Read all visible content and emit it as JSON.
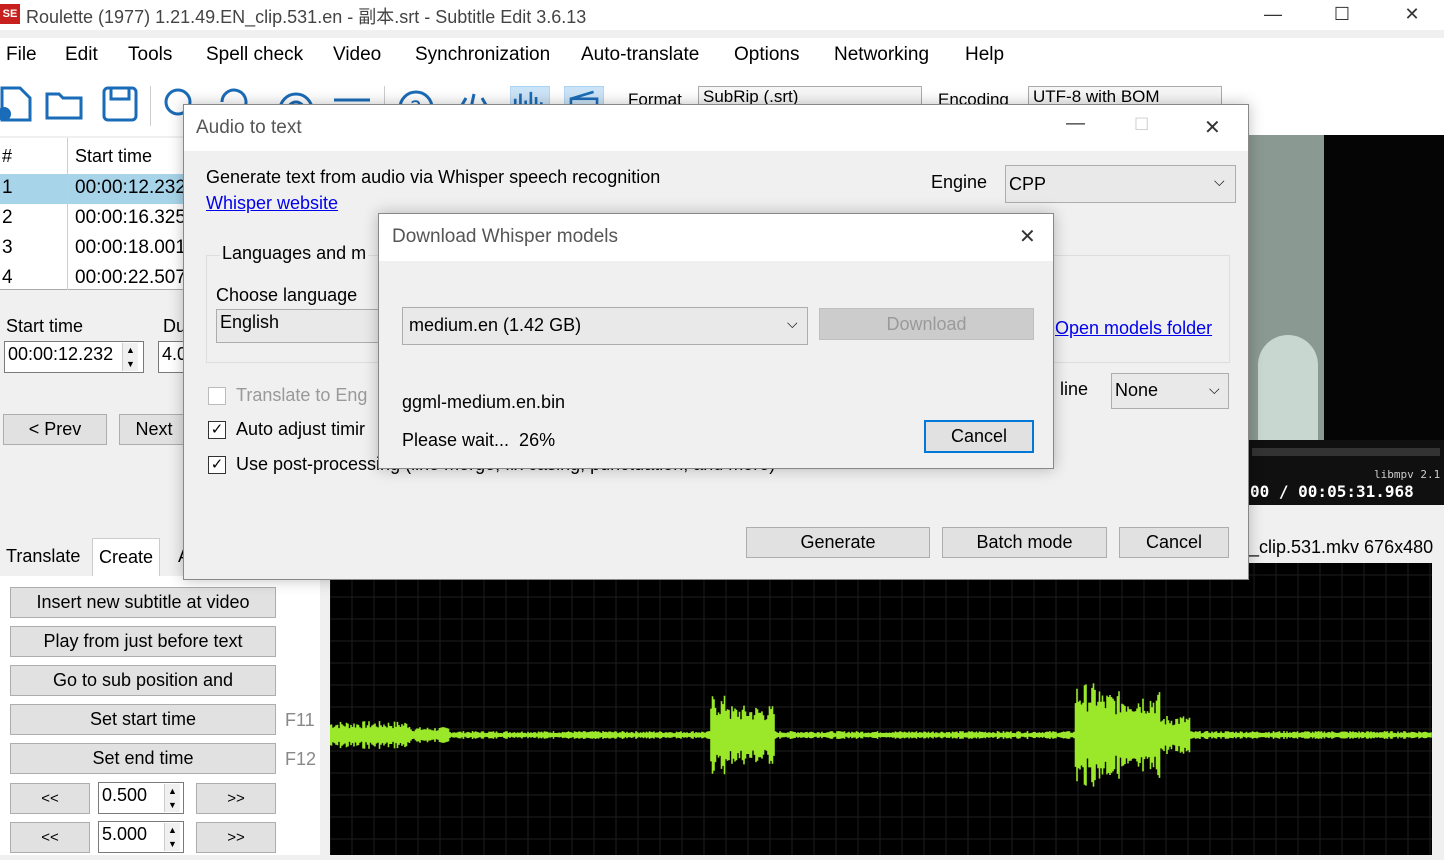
{
  "window": {
    "app_icon": "SE",
    "title": "Roulette (1977) 1.21.49.EN_clip.531.en - 副本.srt - Subtitle Edit 3.6.13",
    "minimize": "—",
    "maximize": "☐",
    "close": "✕"
  },
  "menu": [
    "File",
    "Edit",
    "Tools",
    "Spell check",
    "Video",
    "Synchronization",
    "Auto-translate",
    "Options",
    "Networking",
    "Help"
  ],
  "toolbar": {
    "format_label": "Format",
    "format_value": "SubRip (.srt)",
    "encoding_label": "Encoding",
    "encoding_value": "UTF-8 with BOM"
  },
  "list": {
    "col_num": "#",
    "col_start": "Start time",
    "rows": [
      {
        "num": "1",
        "start": "00:00:12.232"
      },
      {
        "num": "2",
        "start": "00:00:16.325"
      },
      {
        "num": "3",
        "start": "00:00:18.001"
      },
      {
        "num": "4",
        "start": "00:00:22.507"
      }
    ]
  },
  "edit": {
    "start_label": "Start time",
    "duration_label": "Du",
    "start_value": "00:00:12.232",
    "duration_value": "4.0",
    "prev": "< Prev",
    "next": "Next"
  },
  "tabs": [
    "Translate",
    "Create",
    "A"
  ],
  "create": {
    "insert": "Insert new subtitle at video",
    "play": "Play from just before text",
    "goto": "Go to sub position and",
    "set_start": "Set start time",
    "set_start_key": "F11",
    "set_end": "Set end time",
    "set_end_key": "F12",
    "back": "<<",
    "fwd": ">>",
    "step1": "0.500",
    "step2": "5.000"
  },
  "video": {
    "libmpv": "libmpv 2.1",
    "time": "00 / 00:05:31.968",
    "file": "_clip.531.mkv 676x480"
  },
  "audio_dialog": {
    "title": "Audio to text",
    "description": "Generate text from audio via Whisper speech recognition",
    "link": "Whisper website",
    "engine_label": "Engine",
    "engine_value": "CPP",
    "group_label": "Languages and m",
    "choose_language": "Choose language",
    "language_value": "English",
    "translate": "Translate to Eng",
    "auto_adjust": "Auto adjust timir",
    "post_process": "Use post-processing (line merge, fix casing, punctuation, and more)",
    "open_folder": "Open models folder",
    "line_label": "line",
    "line_value": "None",
    "generate": "Generate",
    "batch": "Batch mode",
    "cancel": "Cancel"
  },
  "download_dialog": {
    "title": "Download Whisper models",
    "model_value": "medium.en (1.42 GB)",
    "download": "Download",
    "filename": "ggml-medium.en.bin",
    "status": "Please wait...  26%",
    "cancel": "Cancel",
    "close": "✕"
  },
  "colors": {
    "waveform": "#9be82a",
    "selected_row": "#a8d4ea",
    "link": "#0000ee",
    "app_icon_bg": "#c8201e"
  }
}
